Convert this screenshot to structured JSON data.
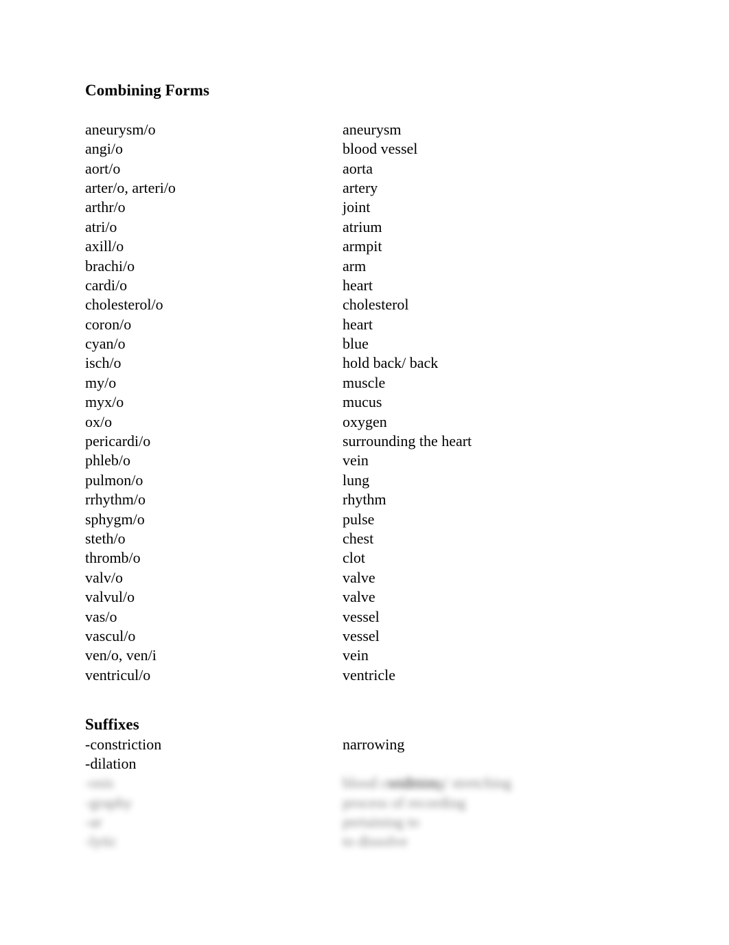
{
  "document": {
    "sections": [
      {
        "id": "combining-forms",
        "heading": "Combining Forms",
        "rows": [
          {
            "term": "aneurysm/o",
            "definition": "aneurysm"
          },
          {
            "term": "angi/o",
            "definition": "blood vessel"
          },
          {
            "term": "aort/o",
            "definition": "aorta"
          },
          {
            "term": "arter/o, arteri/o",
            "definition": "artery"
          },
          {
            "term": "arthr/o",
            "definition": "joint"
          },
          {
            "term": "atri/o",
            "definition": "atrium"
          },
          {
            "term": "axill/o",
            "definition": "armpit"
          },
          {
            "term": "brachi/o",
            "definition": "arm"
          },
          {
            "term": "cardi/o",
            "definition": "heart"
          },
          {
            "term": "cholesterol/o",
            "definition": "cholesterol"
          },
          {
            "term": "coron/o",
            "definition": "heart"
          },
          {
            "term": "cyan/o",
            "definition": "blue"
          },
          {
            "term": "isch/o",
            "definition": "hold back/ back"
          },
          {
            "term": "my/o",
            "definition": "muscle"
          },
          {
            "term": "myx/o",
            "definition": "mucus"
          },
          {
            "term": "ox/o",
            "definition": "oxygen"
          },
          {
            "term": "pericardi/o",
            "definition": "surrounding the heart"
          },
          {
            "term": "phleb/o",
            "definition": "vein"
          },
          {
            "term": "pulmon/o",
            "definition": "lung"
          },
          {
            "term": "rrhythm/o",
            "definition": "rhythm"
          },
          {
            "term": "sphygm/o",
            "definition": "pulse"
          },
          {
            "term": "steth/o",
            "definition": "chest"
          },
          {
            "term": "thromb/o",
            "definition": "clot"
          },
          {
            "term": "valv/o",
            "definition": "valve"
          },
          {
            "term": "valvul/o",
            "definition": "valve"
          },
          {
            "term": "vas/o",
            "definition": "vessel"
          },
          {
            "term": "vascul/o",
            "definition": "vessel"
          },
          {
            "term": "ven/o, ven/i",
            "definition": "vein"
          },
          {
            "term": "ventricul/o",
            "definition": "ventricle"
          }
        ]
      },
      {
        "id": "suffixes",
        "heading": "Suffixes",
        "rows": [
          {
            "term": "-constriction",
            "definition": "narrowing"
          },
          {
            "term": "-dilation",
            "definition": ""
          }
        ],
        "redacted_rows": [
          {
            "term": "",
            "definition": "widening/ stretching"
          },
          {
            "term": "-osis",
            "definition": "blood condition"
          },
          {
            "term": "-graphy",
            "definition": "process of recording"
          },
          {
            "term": "-ar",
            "definition": "pertaining to"
          },
          {
            "term": "-lytic",
            "definition": "to dissolve"
          }
        ]
      }
    ]
  }
}
